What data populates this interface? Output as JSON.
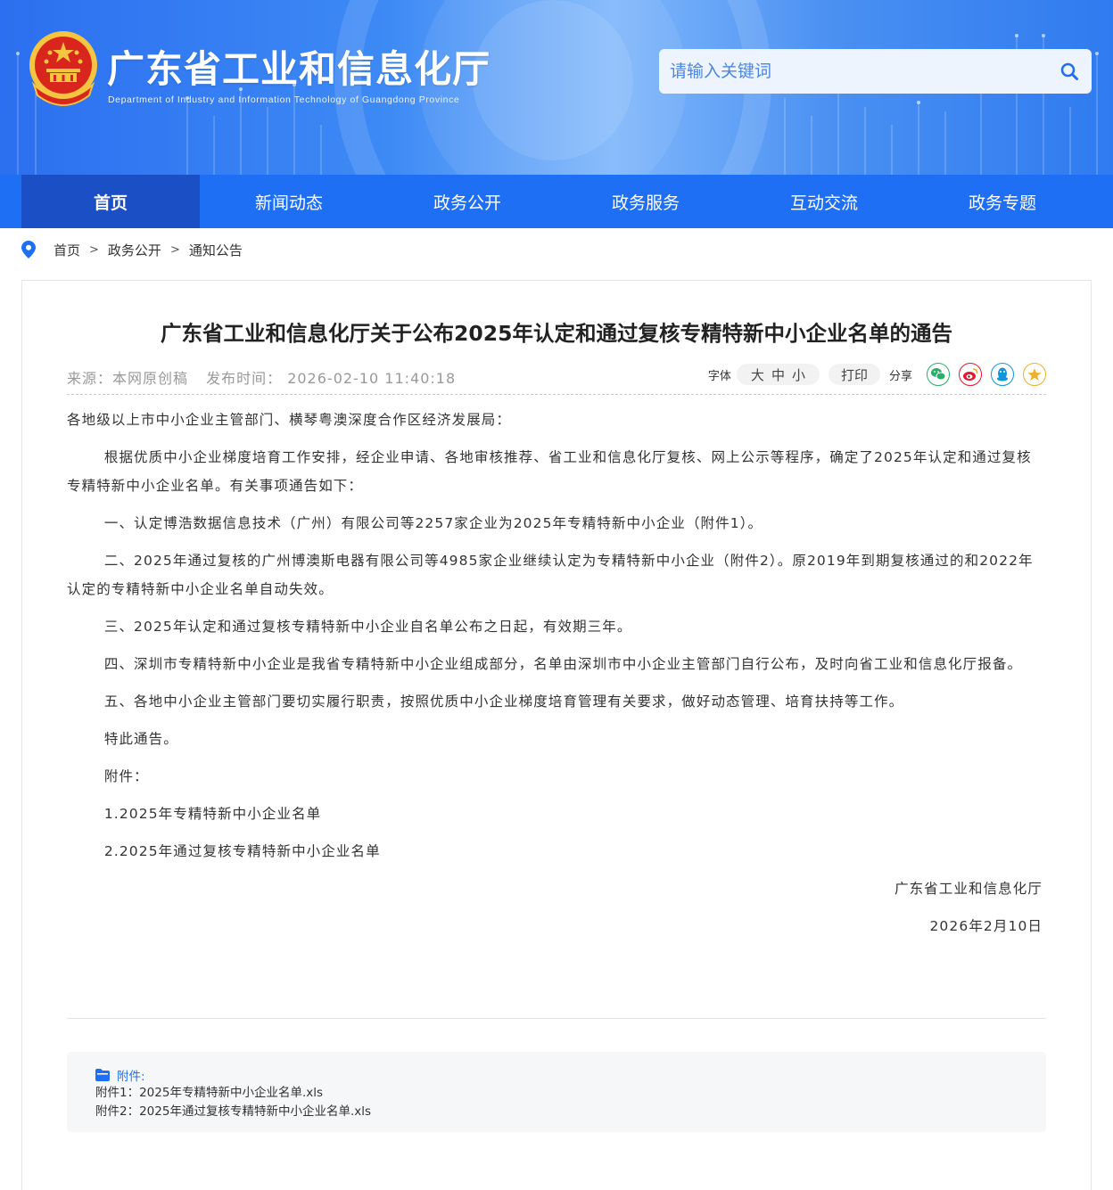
{
  "header": {
    "title": "广东省工业和信息化厅",
    "subtitle": "Department of Industry and Information Technology of Guangdong Province",
    "search_placeholder": "请输入关键词"
  },
  "nav": {
    "items": [
      {
        "label": "首页"
      },
      {
        "label": "新闻动态"
      },
      {
        "label": "政务公开"
      },
      {
        "label": "政务服务"
      },
      {
        "label": "互动交流"
      },
      {
        "label": "政务专题"
      }
    ]
  },
  "breadcrumb": {
    "items": [
      "首页",
      "政务公开",
      "通知公告"
    ],
    "separator": ">"
  },
  "article": {
    "title": "广东省工业和信息化厅关于公布2025年认定和通过复核专精特新中小企业名单的通告",
    "source": "来源：本网原创稿",
    "publish_time": "发布时间： 2026-02-10 11:40:18",
    "paragraphs": [
      "各地级以上市中小企业主管部门、横琴粤澳深度合作区经济发展局：",
      "根据优质中小企业梯度培育工作安排，经企业申请、各地审核推荐、省工业和信息化厅复核、网上公示等程序，确定了2025年认定和通过复核专精特新中小企业名单。有关事项通告如下：",
      "一、认定博浩数据信息技术（广州）有限公司等2257家企业为2025年专精特新中小企业（附件1）。",
      "二、2025年通过复核的广州博澳斯电器有限公司等4985家企业继续认定为专精特新中小企业（附件2）。原2019年到期复核通过的和2022年认定的专精特新中小企业名单自动失效。",
      "三、2025年认定和通过复核专精特新中小企业自名单公布之日起，有效期三年。",
      "四、深圳市专精特新中小企业是我省专精特新中小企业组成部分，名单由深圳市中小企业主管部门自行公布，及时向省工业和信息化厅报备。",
      "五、各地中小企业主管部门要切实履行职责，按照优质中小企业梯度培育管理有关要求，做好动态管理、培育扶持等工作。",
      "特此通告。",
      "附件：",
      "1.2025年专精特新中小企业名单",
      "2.2025年通过复核专精特新中小企业名单"
    ],
    "signature": "广东省工业和信息化厅",
    "date": "2026年2月10日"
  },
  "tools": {
    "font_label": "字体",
    "font_large": "大",
    "font_medium": "中",
    "font_small": "小",
    "print_label": "打印",
    "share_label": "分享"
  },
  "attachments": {
    "heading": "附件:",
    "items": [
      {
        "prefix": "附件1：",
        "name": "2025年专精特新中小企业名单.xls"
      },
      {
        "prefix": "附件2：",
        "name": "2025年通过复核专精特新中小企业名单.xls"
      }
    ]
  },
  "colors": {
    "nav_blue": "#1f6ff5",
    "nav_active": "#1b4fc6",
    "wechat": "#2aae67",
    "weibo": "#e6162d",
    "qq": "#1296db",
    "favorite": "#f0b02a"
  }
}
